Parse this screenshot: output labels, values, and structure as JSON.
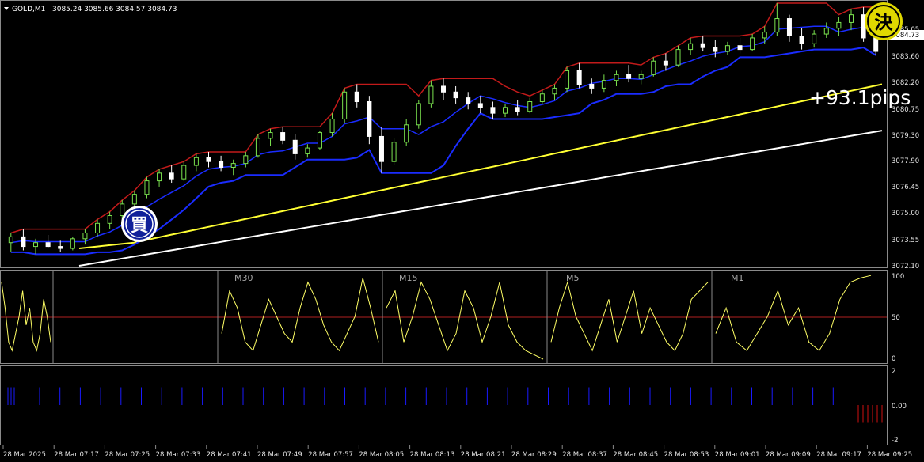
{
  "window": {
    "symbol_title": "GOLD,M1",
    "ohlc_readout": "3085.24 3085.66 3084.57 3084.73",
    "current_price": "3084.73",
    "pips_label": "+93.1pips",
    "buy_badge": "買",
    "close_badge": "決"
  },
  "colors": {
    "background": "#000000",
    "bull_candle": "#7be34f",
    "bear_candle": "#ffffff",
    "ma_fast": "#ffff33",
    "ma_slow": "#ffffff",
    "channel_upper": "#c21a1a",
    "channel_lower": "#1a2cff",
    "stoch_line": "#ffff66",
    "stoch_midline": "#b02020",
    "hist_up": "#1a1aff",
    "hist_down": "#d01010",
    "buy_badge_fill": "#10209a",
    "close_badge_fill": "#e0d800"
  },
  "axes": {
    "price_ticks": [
      "3085.05",
      "3083.60",
      "3082.20",
      "3080.75",
      "3079.30",
      "3077.90",
      "3076.45",
      "3075.00",
      "3073.55",
      "3072.10"
    ],
    "stoch_ticks": [
      "100",
      "50",
      "0"
    ],
    "hist_ticks": [
      "2",
      "0.00",
      "-2"
    ],
    "time_ticks": [
      "28 Mar 2025",
      "28 Mar 07:17",
      "28 Mar 07:25",
      "28 Mar 07:33",
      "28 Mar 07:41",
      "28 Mar 07:49",
      "28 Mar 07:57",
      "28 Mar 08:05",
      "28 Mar 08:13",
      "28 Mar 08:21",
      "28 Mar 08:29",
      "28 Mar 08:37",
      "28 Mar 08:45",
      "28 Mar 08:53",
      "28 Mar 09:01",
      "28 Mar 09:09",
      "28 Mar 09:17",
      "28 Mar 09:25"
    ]
  },
  "chart_data": [
    {
      "type": "candlestick",
      "title": "GOLD,M1",
      "ylim": [
        3072.0,
        3085.6
      ],
      "grid": false,
      "ohlc": [
        {
          "o": 3073.2,
          "h": 3073.7,
          "l": 3072.7,
          "c": 3073.5
        },
        {
          "o": 3073.5,
          "h": 3073.9,
          "l": 3072.8,
          "c": 3073.0
        },
        {
          "o": 3073.0,
          "h": 3073.4,
          "l": 3072.6,
          "c": 3073.2
        },
        {
          "o": 3073.2,
          "h": 3073.6,
          "l": 3072.9,
          "c": 3073.0
        },
        {
          "o": 3073.0,
          "h": 3073.3,
          "l": 3072.7,
          "c": 3072.9
        },
        {
          "o": 3072.9,
          "h": 3073.5,
          "l": 3072.8,
          "c": 3073.4
        },
        {
          "o": 3073.4,
          "h": 3073.9,
          "l": 3073.1,
          "c": 3073.7
        },
        {
          "o": 3073.7,
          "h": 3074.4,
          "l": 3073.5,
          "c": 3074.2
        },
        {
          "o": 3074.2,
          "h": 3074.8,
          "l": 3073.9,
          "c": 3074.6
        },
        {
          "o": 3074.6,
          "h": 3075.4,
          "l": 3074.4,
          "c": 3075.2
        },
        {
          "o": 3075.2,
          "h": 3075.9,
          "l": 3074.9,
          "c": 3075.7
        },
        {
          "o": 3075.7,
          "h": 3076.6,
          "l": 3075.5,
          "c": 3076.4
        },
        {
          "o": 3076.4,
          "h": 3077.0,
          "l": 3076.1,
          "c": 3076.8
        },
        {
          "o": 3076.8,
          "h": 3077.2,
          "l": 3076.3,
          "c": 3076.5
        },
        {
          "o": 3076.5,
          "h": 3077.4,
          "l": 3076.4,
          "c": 3077.2
        },
        {
          "o": 3077.2,
          "h": 3077.8,
          "l": 3076.9,
          "c": 3077.6
        },
        {
          "o": 3077.6,
          "h": 3077.9,
          "l": 3077.1,
          "c": 3077.4
        },
        {
          "o": 3077.4,
          "h": 3077.7,
          "l": 3076.9,
          "c": 3077.1
        },
        {
          "o": 3077.1,
          "h": 3077.5,
          "l": 3076.7,
          "c": 3077.3
        },
        {
          "o": 3077.3,
          "h": 3077.9,
          "l": 3077.1,
          "c": 3077.7
        },
        {
          "o": 3077.7,
          "h": 3078.8,
          "l": 3077.6,
          "c": 3078.6
        },
        {
          "o": 3078.6,
          "h": 3079.1,
          "l": 3078.2,
          "c": 3078.9
        },
        {
          "o": 3078.9,
          "h": 3079.2,
          "l": 3078.3,
          "c": 3078.5
        },
        {
          "o": 3078.5,
          "h": 3078.8,
          "l": 3077.5,
          "c": 3077.8
        },
        {
          "o": 3077.8,
          "h": 3078.3,
          "l": 3077.6,
          "c": 3078.1
        },
        {
          "o": 3078.1,
          "h": 3079.0,
          "l": 3078.0,
          "c": 3078.9
        },
        {
          "o": 3078.9,
          "h": 3079.9,
          "l": 3078.7,
          "c": 3079.6
        },
        {
          "o": 3079.6,
          "h": 3081.2,
          "l": 3079.4,
          "c": 3081.0
        },
        {
          "o": 3081.0,
          "h": 3081.4,
          "l": 3080.2,
          "c": 3080.5
        },
        {
          "o": 3080.5,
          "h": 3080.8,
          "l": 3078.3,
          "c": 3078.7
        },
        {
          "o": 3078.7,
          "h": 3079.2,
          "l": 3076.8,
          "c": 3077.4
        },
        {
          "o": 3077.4,
          "h": 3078.6,
          "l": 3077.2,
          "c": 3078.4
        },
        {
          "o": 3078.4,
          "h": 3079.6,
          "l": 3078.2,
          "c": 3079.3
        },
        {
          "o": 3079.3,
          "h": 3080.6,
          "l": 3079.1,
          "c": 3080.4
        },
        {
          "o": 3080.4,
          "h": 3081.6,
          "l": 3080.2,
          "c": 3081.3
        },
        {
          "o": 3081.3,
          "h": 3081.7,
          "l": 3080.6,
          "c": 3081.0
        },
        {
          "o": 3081.0,
          "h": 3081.3,
          "l": 3080.4,
          "c": 3080.7
        },
        {
          "o": 3080.7,
          "h": 3081.0,
          "l": 3080.1,
          "c": 3080.4
        },
        {
          "o": 3080.4,
          "h": 3080.8,
          "l": 3079.9,
          "c": 3080.2
        },
        {
          "o": 3080.2,
          "h": 3080.5,
          "l": 3079.6,
          "c": 3079.9
        },
        {
          "o": 3079.9,
          "h": 3080.4,
          "l": 3079.7,
          "c": 3080.2
        },
        {
          "o": 3080.2,
          "h": 3080.6,
          "l": 3079.8,
          "c": 3080.0
        },
        {
          "o": 3080.0,
          "h": 3080.7,
          "l": 3079.9,
          "c": 3080.5
        },
        {
          "o": 3080.5,
          "h": 3081.1,
          "l": 3080.4,
          "c": 3080.9
        },
        {
          "o": 3080.9,
          "h": 3081.4,
          "l": 3080.6,
          "c": 3081.2
        },
        {
          "o": 3081.2,
          "h": 3082.3,
          "l": 3081.0,
          "c": 3082.1
        },
        {
          "o": 3082.1,
          "h": 3082.5,
          "l": 3081.2,
          "c": 3081.4
        },
        {
          "o": 3081.4,
          "h": 3081.7,
          "l": 3080.9,
          "c": 3081.2
        },
        {
          "o": 3081.2,
          "h": 3081.9,
          "l": 3081.0,
          "c": 3081.6
        },
        {
          "o": 3081.6,
          "h": 3082.1,
          "l": 3081.3,
          "c": 3081.9
        },
        {
          "o": 3081.9,
          "h": 3082.4,
          "l": 3081.5,
          "c": 3081.7
        },
        {
          "o": 3081.7,
          "h": 3082.1,
          "l": 3081.4,
          "c": 3081.9
        },
        {
          "o": 3081.9,
          "h": 3082.8,
          "l": 3081.8,
          "c": 3082.6
        },
        {
          "o": 3082.6,
          "h": 3083.0,
          "l": 3082.1,
          "c": 3082.4
        },
        {
          "o": 3082.4,
          "h": 3083.4,
          "l": 3082.3,
          "c": 3083.2
        },
        {
          "o": 3083.2,
          "h": 3083.8,
          "l": 3082.9,
          "c": 3083.5
        },
        {
          "o": 3083.5,
          "h": 3083.9,
          "l": 3083.1,
          "c": 3083.3
        },
        {
          "o": 3083.3,
          "h": 3083.7,
          "l": 3082.8,
          "c": 3083.1
        },
        {
          "o": 3083.1,
          "h": 3083.6,
          "l": 3082.9,
          "c": 3083.4
        },
        {
          "o": 3083.4,
          "h": 3083.8,
          "l": 3083.0,
          "c": 3083.2
        },
        {
          "o": 3083.2,
          "h": 3084.0,
          "l": 3083.1,
          "c": 3083.8
        },
        {
          "o": 3083.8,
          "h": 3084.4,
          "l": 3083.5,
          "c": 3084.1
        },
        {
          "o": 3084.1,
          "h": 3085.6,
          "l": 3083.9,
          "c": 3084.8
        },
        {
          "o": 3084.8,
          "h": 3085.0,
          "l": 3083.6,
          "c": 3083.9
        },
        {
          "o": 3083.9,
          "h": 3084.3,
          "l": 3083.2,
          "c": 3083.5
        },
        {
          "o": 3083.5,
          "h": 3084.2,
          "l": 3083.3,
          "c": 3084.0
        },
        {
          "o": 3084.0,
          "h": 3084.6,
          "l": 3083.8,
          "c": 3084.3
        },
        {
          "o": 3084.3,
          "h": 3084.9,
          "l": 3083.9,
          "c": 3084.6
        },
        {
          "o": 3084.6,
          "h": 3085.3,
          "l": 3084.2,
          "c": 3085.0
        },
        {
          "o": 3085.0,
          "h": 3085.4,
          "l": 3083.6,
          "c": 3083.8
        },
        {
          "o": 3083.8,
          "h": 3084.2,
          "l": 3082.9,
          "c": 3083.1
        }
      ],
      "series": [
        {
          "values": [
            3072.9,
            3073.0,
            3073.1,
            3073.2,
            3073.4,
            3073.6,
            3073.8,
            3074.0,
            3074.2,
            3074.4,
            3074.6,
            3074.8,
            3075.0,
            3075.2,
            3075.4,
            3075.6,
            3075.8,
            3076.0,
            3076.2,
            3076.4,
            3076.6,
            3076.8,
            3077.0,
            3077.2,
            3077.4,
            3077.6,
            3077.8,
            3078.0,
            3078.2,
            3078.4,
            3078.6,
            3078.8,
            3079.0,
            3079.2,
            3079.4,
            3079.6,
            3079.8,
            3080.0,
            3080.2,
            3080.4,
            3080.6,
            3080.8,
            3081.0,
            3081.2,
            3081.4
          ]
        },
        {
          "values": [
            3072.0,
            3072.2,
            3072.4,
            3072.6,
            3072.8,
            3073.0,
            3073.2,
            3073.4,
            3073.6,
            3073.8,
            3074.0,
            3074.2,
            3074.4,
            3074.6,
            3074.8,
            3075.0,
            3075.2,
            3075.4,
            3075.6,
            3075.8,
            3076.0,
            3076.2,
            3076.4,
            3076.6,
            3076.8,
            3077.0,
            3077.2,
            3077.4,
            3077.6,
            3077.8,
            3078.0,
            3078.2,
            3078.4,
            3078.6,
            3078.8,
            3079.0
          ]
        }
      ]
    },
    {
      "type": "line",
      "ylim": [
        0,
        100
      ],
      "panes": [
        "",
        "M30",
        "M15",
        "M5",
        "M1"
      ],
      "midline": 50,
      "series": [
        {
          "values": [
            90,
            60,
            20,
            10,
            30,
            50,
            80,
            40,
            60,
            20,
            10,
            30,
            70,
            50,
            20
          ]
        },
        {
          "values": [
            30,
            80,
            60,
            20,
            10,
            40,
            70,
            50,
            30,
            20,
            60,
            90,
            70,
            40,
            20,
            10,
            30,
            50,
            95,
            60,
            20
          ]
        },
        {
          "values": [
            60,
            80,
            20,
            50,
            90,
            70,
            40,
            10,
            30,
            80,
            60,
            20,
            50,
            90,
            40,
            20,
            10,
            5,
            0
          ]
        },
        {
          "values": [
            20,
            60,
            90,
            50,
            30,
            10,
            40,
            70,
            20,
            50,
            80,
            30,
            60,
            40,
            20,
            10,
            30,
            70,
            80,
            90
          ]
        },
        {
          "values": [
            30,
            60,
            20,
            10,
            30,
            50,
            80,
            40,
            60,
            20,
            10,
            30,
            70,
            90,
            95,
            98
          ]
        }
      ]
    },
    {
      "type": "bar",
      "ylim": [
        -2,
        2
      ],
      "series": [
        {
          "name": "up",
          "values": [
            1,
            1,
            1,
            1,
            1,
            1,
            1,
            1,
            1,
            1,
            1,
            1,
            1,
            1,
            1,
            1,
            1,
            1,
            1,
            1,
            1,
            1,
            1,
            1,
            1,
            1,
            1,
            1,
            1,
            1,
            1,
            1,
            1,
            1,
            1,
            1,
            1,
            1,
            1,
            1
          ]
        },
        {
          "name": "down",
          "values": [
            -1,
            -1,
            -1,
            -1,
            -1,
            -1
          ]
        }
      ]
    }
  ]
}
